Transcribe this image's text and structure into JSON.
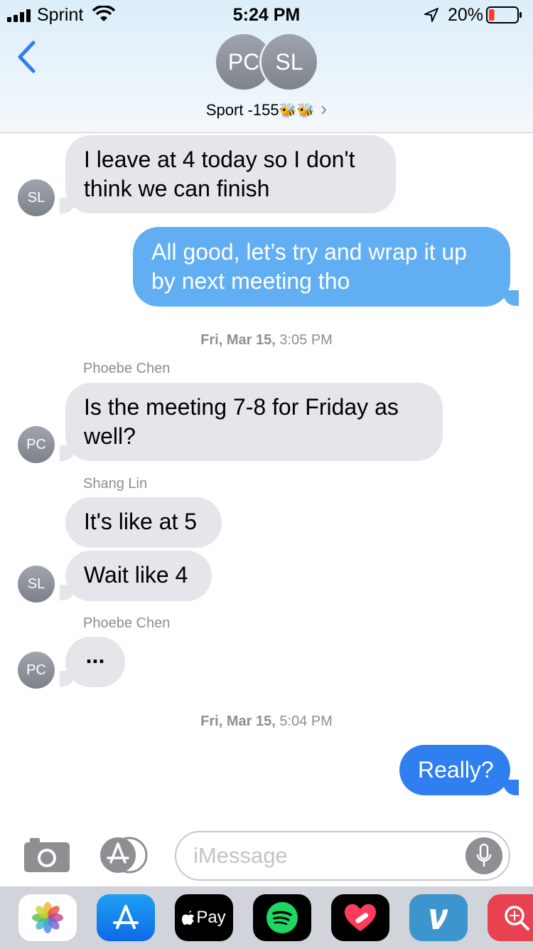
{
  "status_bar": {
    "carrier": "Sprint",
    "time": "5:24 PM",
    "battery": "20%",
    "battery_level": 0.2
  },
  "header": {
    "participants": [
      "PC",
      "SL"
    ],
    "group_name": "Sport -155",
    "group_emoji": "🐝🐝",
    "chevron": "›"
  },
  "messages": [
    {
      "type": "in",
      "sender": "SL",
      "lines": [
        "I leave at 4 today so I don't",
        "think we can finish"
      ]
    },
    {
      "type": "out",
      "lines": [
        "All good, let’s try and wrap it up",
        "by next meeting tho"
      ]
    }
  ],
  "timestamp_1": {
    "day": "Fri, Mar 15,",
    "time": " 3:05 PM"
  },
  "thread_1": [
    {
      "sender_name": "Phoebe Chen",
      "initials": "PC",
      "lines": [
        "Is the meeting 7-8 for Friday as",
        "well?"
      ]
    },
    {
      "sender_name": "Shang Lin",
      "initials": "SL",
      "bubbles": [
        "It's like at 5",
        "Wait like 4"
      ]
    },
    {
      "sender_name": "Phoebe Chen",
      "initials": "PC",
      "typing": "..."
    }
  ],
  "timestamp_2": {
    "day": "Fri, Mar 15,",
    "time": " 5:04 PM"
  },
  "last_message": {
    "type": "out",
    "text": "Really?"
  },
  "composer": {
    "placeholder": "iMessage"
  },
  "app_drawer": {
    "apps": [
      "photos-icon",
      "app-store-icon",
      "apple-pay-icon",
      "spotify-icon",
      "heart-app-icon",
      "venmo-icon",
      "search-app-icon"
    ],
    "apple_pay_label": "Pay"
  },
  "colors": {
    "incoming_bubble": "#e5e5ea",
    "outgoing_bubble": "#2f7ff0",
    "outgoing_sending": "#62aef3",
    "ios_blue": "#2f7ff0"
  }
}
